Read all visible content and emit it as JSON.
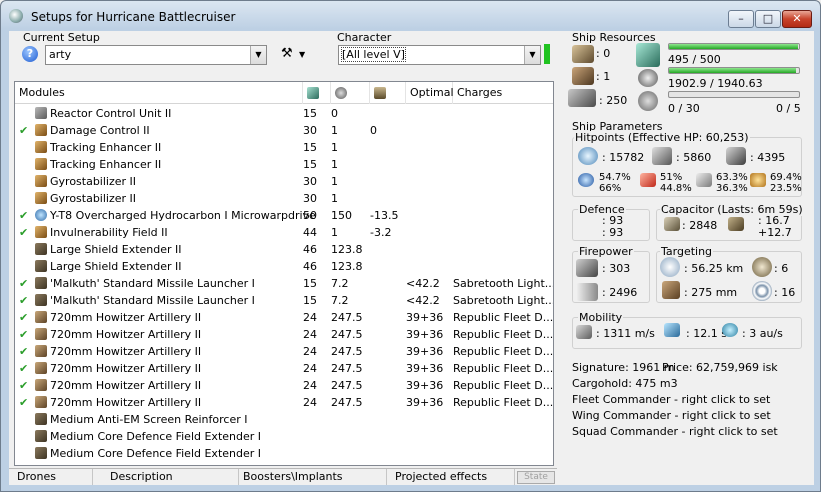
{
  "window": {
    "title": "Setups for Hurricane Battlecruiser"
  },
  "setup": {
    "current_setup_label": "Current Setup",
    "current_setup_value": "arty",
    "character_label": "Character",
    "character_value": "[All level V]"
  },
  "modules": {
    "headers": {
      "name": "Modules",
      "optimal": "Optimal",
      "charges": "Charges"
    },
    "rows": [
      {
        "active": false,
        "name": "Reactor Control Unit II",
        "cpu": "15",
        "pg": "0",
        "cap": "",
        "optimal": "",
        "charges": "",
        "icon": "icon-gen"
      },
      {
        "active": true,
        "name": "Damage Control II",
        "cpu": "30",
        "pg": "1",
        "cap": "0",
        "optimal": "",
        "charges": "",
        "icon": "icon-brown"
      },
      {
        "active": false,
        "name": "Tracking Enhancer II",
        "cpu": "15",
        "pg": "1",
        "cap": "",
        "optimal": "",
        "charges": "",
        "icon": "icon-brown"
      },
      {
        "active": false,
        "name": "Tracking Enhancer II",
        "cpu": "15",
        "pg": "1",
        "cap": "",
        "optimal": "",
        "charges": "",
        "icon": "icon-brown"
      },
      {
        "active": false,
        "name": "Gyrostabilizer II",
        "cpu": "30",
        "pg": "1",
        "cap": "",
        "optimal": "",
        "charges": "",
        "icon": "icon-brown"
      },
      {
        "active": false,
        "name": "Gyrostabilizer II",
        "cpu": "30",
        "pg": "1",
        "cap": "",
        "optimal": "",
        "charges": "",
        "icon": "icon-brown"
      },
      {
        "active": true,
        "name": "Y-T8 Overcharged Hydrocarbon I Microwarpdrive",
        "cpu": "50",
        "pg": "150",
        "cap": "-13.5",
        "optimal": "",
        "charges": "",
        "icon": "icon-blue"
      },
      {
        "active": true,
        "name": "Invulnerability Field II",
        "cpu": "44",
        "pg": "1",
        "cap": "-3.2",
        "optimal": "",
        "charges": "",
        "icon": "icon-brown"
      },
      {
        "active": false,
        "name": "Large Shield Extender II",
        "cpu": "46",
        "pg": "123.8",
        "cap": "",
        "optimal": "",
        "charges": "",
        "icon": "icon-dark"
      },
      {
        "active": false,
        "name": "Large Shield Extender II",
        "cpu": "46",
        "pg": "123.8",
        "cap": "",
        "optimal": "",
        "charges": "",
        "icon": "icon-dark"
      },
      {
        "active": true,
        "name": "'Malkuth' Standard Missile Launcher I",
        "cpu": "15",
        "pg": "7.2",
        "cap": "",
        "optimal": "<42.2",
        "charges": "Sabretooth Light...",
        "icon": "icon-dark"
      },
      {
        "active": true,
        "name": "'Malkuth' Standard Missile Launcher I",
        "cpu": "15",
        "pg": "7.2",
        "cap": "",
        "optimal": "<42.2",
        "charges": "Sabretooth Light...",
        "icon": "icon-dark"
      },
      {
        "active": true,
        "name": "720mm Howitzer Artillery II",
        "cpu": "24",
        "pg": "247.5",
        "cap": "",
        "optimal": "39+36",
        "charges": "Republic Fleet D...",
        "icon": "icon-gun"
      },
      {
        "active": true,
        "name": "720mm Howitzer Artillery II",
        "cpu": "24",
        "pg": "247.5",
        "cap": "",
        "optimal": "39+36",
        "charges": "Republic Fleet D...",
        "icon": "icon-gun"
      },
      {
        "active": true,
        "name": "720mm Howitzer Artillery II",
        "cpu": "24",
        "pg": "247.5",
        "cap": "",
        "optimal": "39+36",
        "charges": "Republic Fleet D...",
        "icon": "icon-gun"
      },
      {
        "active": true,
        "name": "720mm Howitzer Artillery II",
        "cpu": "24",
        "pg": "247.5",
        "cap": "",
        "optimal": "39+36",
        "charges": "Republic Fleet D...",
        "icon": "icon-gun"
      },
      {
        "active": true,
        "name": "720mm Howitzer Artillery II",
        "cpu": "24",
        "pg": "247.5",
        "cap": "",
        "optimal": "39+36",
        "charges": "Republic Fleet D...",
        "icon": "icon-gun"
      },
      {
        "active": true,
        "name": "720mm Howitzer Artillery II",
        "cpu": "24",
        "pg": "247.5",
        "cap": "",
        "optimal": "39+36",
        "charges": "Republic Fleet D...",
        "icon": "icon-gun"
      },
      {
        "active": false,
        "name": "Medium Anti-EM Screen Reinforcer I",
        "cpu": "",
        "pg": "",
        "cap": "",
        "optimal": "",
        "charges": "",
        "icon": "icon-dark"
      },
      {
        "active": false,
        "name": "Medium Core Defence Field Extender I",
        "cpu": "",
        "pg": "",
        "cap": "",
        "optimal": "",
        "charges": "",
        "icon": "icon-dark"
      },
      {
        "active": false,
        "name": "Medium Core Defence Field Extender I",
        "cpu": "",
        "pg": "",
        "cap": "",
        "optimal": "",
        "charges": "",
        "icon": "icon-dark"
      }
    ]
  },
  "tabs": {
    "drones": "Drones",
    "description": "Description",
    "boosters": "Boosters\\Implants",
    "projected": "Projected effects",
    "state": "State"
  },
  "resources": {
    "title": "Ship Resources",
    "turret_hardpoints": ": 0",
    "launcher_hardpoints": ": 1",
    "calibration": ": 250",
    "cpu_text": "495 / 500",
    "cpu_fraction": 0.99,
    "powergrid_text": "1902.9 / 1940.63",
    "powergrid_fraction": 0.98,
    "drone_bay_text": "0 / 30",
    "drone_bay_fraction": 0,
    "drones_active_text": "0 / 5"
  },
  "params": {
    "title": "Ship Parameters",
    "hitpoints_title": "Hitpoints (Effective HP: 60,253)",
    "shield_hp": ": 15782",
    "armor_hp": ": 5860",
    "structure_hp": ": 4395",
    "res_shield": [
      "54.7%",
      "66%"
    ],
    "res_armor_th": [
      "51%",
      "44.8%"
    ],
    "res_kin": [
      "63.3%",
      "36.3%"
    ],
    "res_exp": [
      "69.4%",
      "23.5%"
    ],
    "defence_title": "Defence",
    "defence_1": ": 93",
    "defence_2": ": 93",
    "capacitor_title": "Capacitor (Lasts: 6m 59s)",
    "capacitor_amount": ": 2848",
    "capacitor_delta_1": ": 16.7",
    "capacitor_delta_2": "+12.7",
    "firepower_title": "Firepower",
    "dps": ": 303",
    "volley": ": 2496",
    "targeting_title": "Targeting",
    "target_range": ": 56.25 km",
    "max_targets": ": 6",
    "scan_res": ": 275 mm",
    "sensor_strength": ": 16",
    "mobility_title": "Mobility",
    "velocity": ": 1311 m/s",
    "align_time": ": 12.1 s",
    "warp_speed": ": 3 au/s"
  },
  "summary": {
    "signature": "Signature: 1961 m",
    "price": "Price: 62,759,969 isk",
    "cargohold": "Cargohold: 475 m3",
    "fleet_commander": "Fleet Commander - right click to set",
    "wing_commander": "Wing Commander - right click to set",
    "squad_commander": "Squad Commander - right click to set"
  },
  "colors": {
    "active_check": "#2a9d2a",
    "bar_fill": "#25a825",
    "close_button": "#c8432b"
  }
}
